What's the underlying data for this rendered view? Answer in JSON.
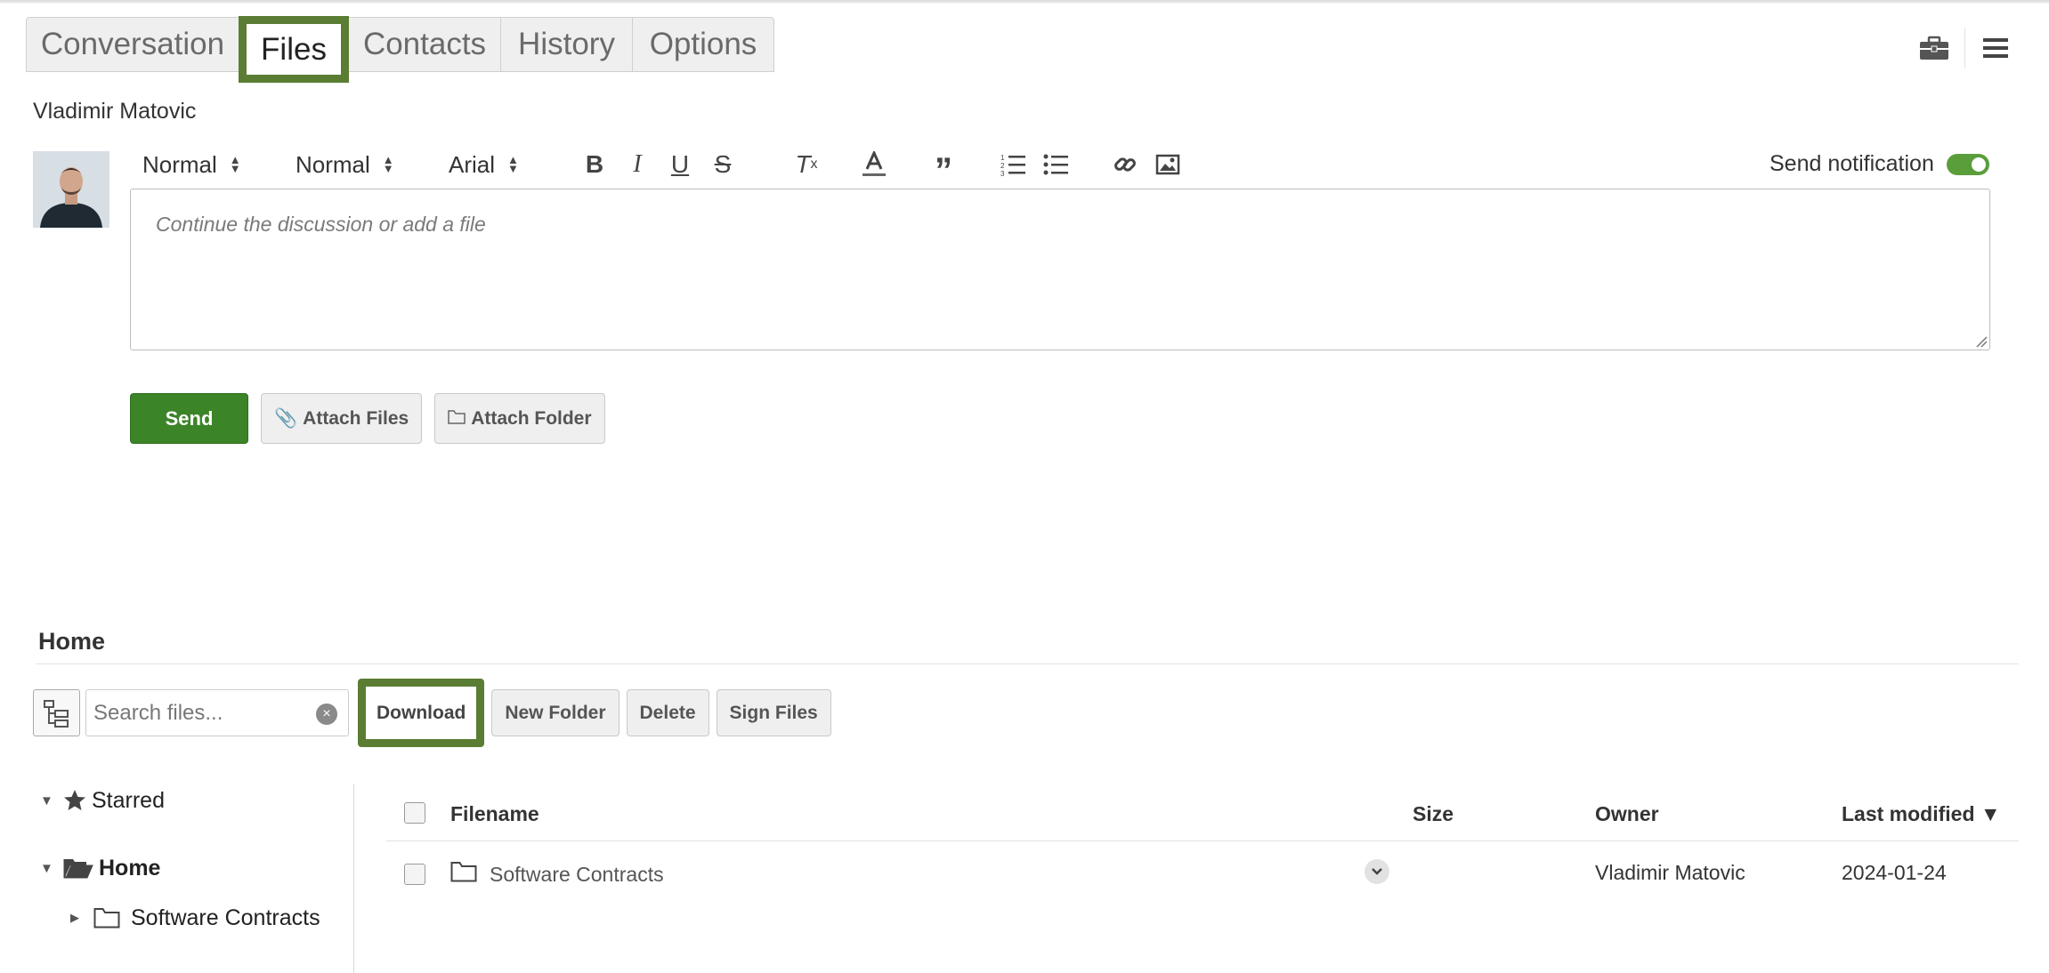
{
  "tabs": [
    {
      "label": "Conversation"
    },
    {
      "label": "Files"
    },
    {
      "label": "Contacts"
    },
    {
      "label": "History"
    },
    {
      "label": "Options"
    }
  ],
  "active_tab": "Files",
  "top_icons": [
    "briefcase-icon",
    "hamburger-menu-icon"
  ],
  "author": "Vladimir Matovic",
  "toolbar": {
    "heading_select": "Normal",
    "size_select": "Normal",
    "font_select": "Arial",
    "buttons": [
      "bold",
      "italic",
      "underline",
      "strikethrough",
      "clear-format",
      "text-color",
      "blockquote",
      "ordered-list",
      "bullet-list",
      "link",
      "image"
    ]
  },
  "notification": {
    "label": "Send notification",
    "enabled": true
  },
  "editor": {
    "placeholder": "Continue the discussion or add a file"
  },
  "actions": {
    "send": "Send",
    "attach_files": "Attach Files",
    "attach_folder": "Attach Folder"
  },
  "files": {
    "title": "Home",
    "search_placeholder": "Search files...",
    "buttons": {
      "download": "Download",
      "new_folder": "New Folder",
      "delete": "Delete",
      "sign_files": "Sign Files"
    },
    "tree": {
      "starred": "Starred",
      "home": "Home",
      "child": "Software Contracts"
    },
    "columns": {
      "filename": "Filename",
      "size": "Size",
      "owner": "Owner",
      "last_modified": "Last modified ▼"
    },
    "rows": [
      {
        "name": "Software Contracts",
        "size": "",
        "owner": "Vladimir Matovic",
        "modified": "2024-01-24"
      }
    ]
  },
  "colors": {
    "accent_green": "#3b8427",
    "highlight_border": "#5a7d33"
  }
}
